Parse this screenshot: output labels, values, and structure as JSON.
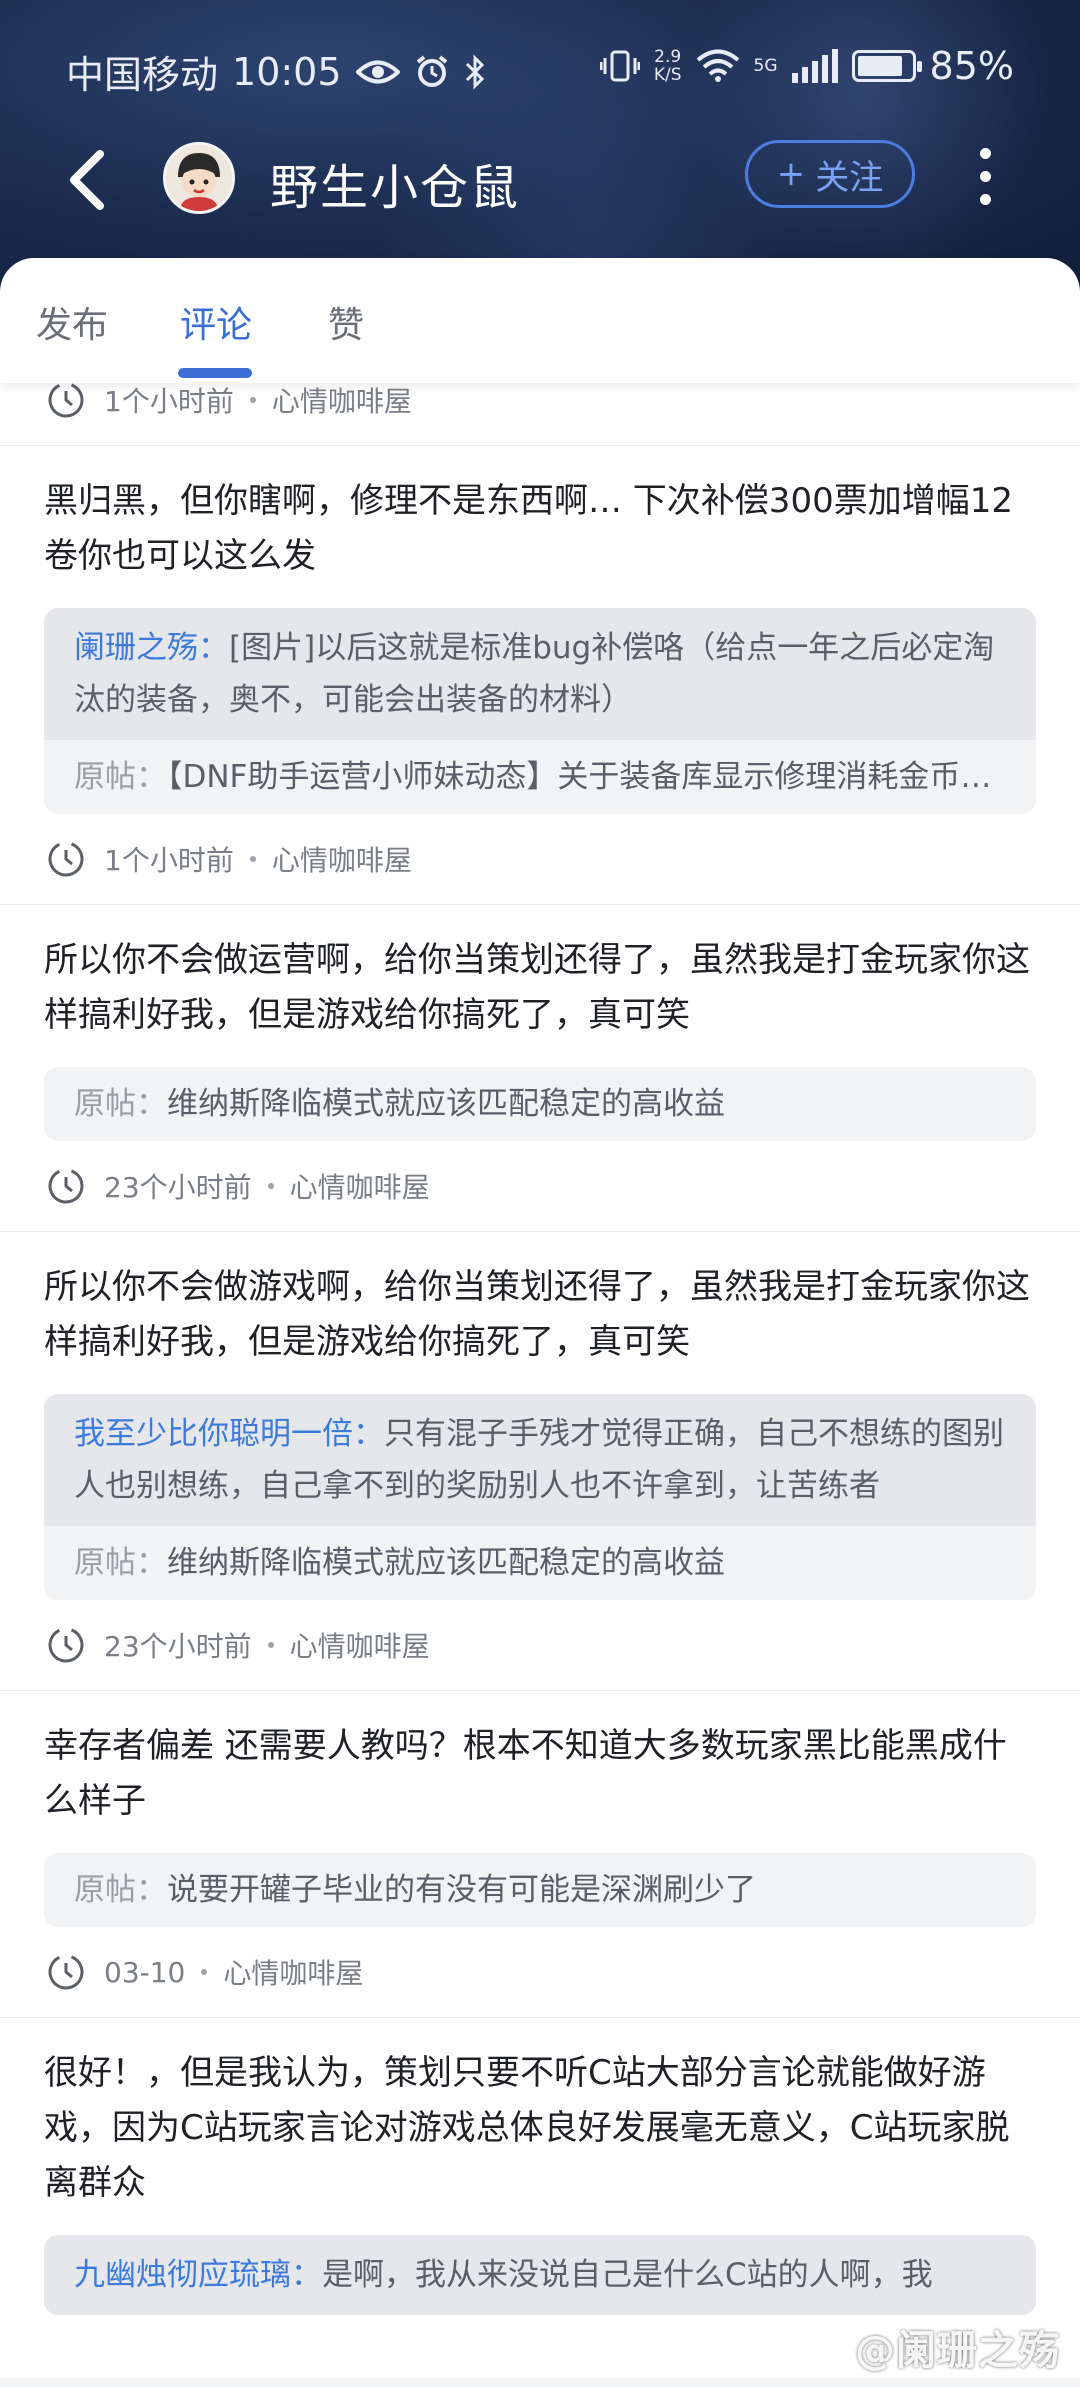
{
  "status_bar": {
    "carrier": "中国移动",
    "time": "10:05",
    "net_speed_value": "2.9",
    "net_speed_unit": "K/S",
    "network_type": "5G",
    "battery": "85%",
    "battery_level": 0.85
  },
  "header": {
    "user_name": "野生小仓鼠",
    "follow_label": "关注",
    "follow_plus": "+"
  },
  "tabs": [
    {
      "label": "发布",
      "active": false
    },
    {
      "label": "评论",
      "active": true
    },
    {
      "label": "赞",
      "active": false
    }
  ],
  "items": [
    {
      "meta": {
        "time": "1个小时前",
        "board": "心情咖啡屋"
      }
    },
    {
      "text": "黑归黑，但你瞎啊，修理不是东西啊… 下次补偿300票加增幅12卷你也可以这么发",
      "reply_user": "阑珊之殇：",
      "reply_text": "[图片]以后这就是标准bug补偿咯（给点一年之后必定淘汰的装备，奥不，可能会出装备的材料）",
      "orig_label": "原帖：",
      "orig_text": "【DNF助手运营小师妹动态】关于装备库显示修理消耗金币的问题",
      "meta": {
        "time": "1个小时前",
        "board": "心情咖啡屋"
      }
    },
    {
      "text": "所以你不会做运营啊，给你当策划还得了，虽然我是打金玩家你这样搞利好我，但是游戏给你搞死了，真可笑",
      "orig_label": "原帖：",
      "orig_text": "维纳斯降临模式就应该匹配稳定的高收益",
      "meta": {
        "time": "23个小时前",
        "board": "心情咖啡屋"
      }
    },
    {
      "text": "所以你不会做游戏啊，给你当策划还得了，虽然我是打金玩家你这样搞利好我，但是游戏给你搞死了，真可笑",
      "reply_user": "我至少比你聪明一倍：",
      "reply_text": "只有混子手残才觉得正确，自己不想练的图别人也别想练，自己拿不到的奖励别人也不许拿到，让苦练者",
      "orig_label": "原帖：",
      "orig_text": "维纳斯降临模式就应该匹配稳定的高收益",
      "meta": {
        "time": "23个小时前",
        "board": "心情咖啡屋"
      }
    },
    {
      "text": "幸存者偏差 还需要人教吗？根本不知道大多数玩家黑比能黑成什么样子",
      "orig_label": "原帖：",
      "orig_text": "说要开罐子毕业的有没有可能是深渊刷少了",
      "meta": {
        "time": "03-10",
        "board": "心情咖啡屋"
      }
    },
    {
      "text": "很好！，但是我认为，策划只要不听C站大部分言论就能做好游戏，因为C站玩家言论对游戏总体良好发展毫无意义，C站玩家脱离群众",
      "reply_user": "九幽烛彻应琉璃：",
      "reply_text": "是啊，我从来没说自己是什么C站的人啊，我"
    }
  ],
  "watermark": "@阑珊之殇",
  "colors": {
    "accent": "#3b6fd6",
    "reply_name": "#3c7bdb",
    "header_bg": "#1b2b4e"
  }
}
